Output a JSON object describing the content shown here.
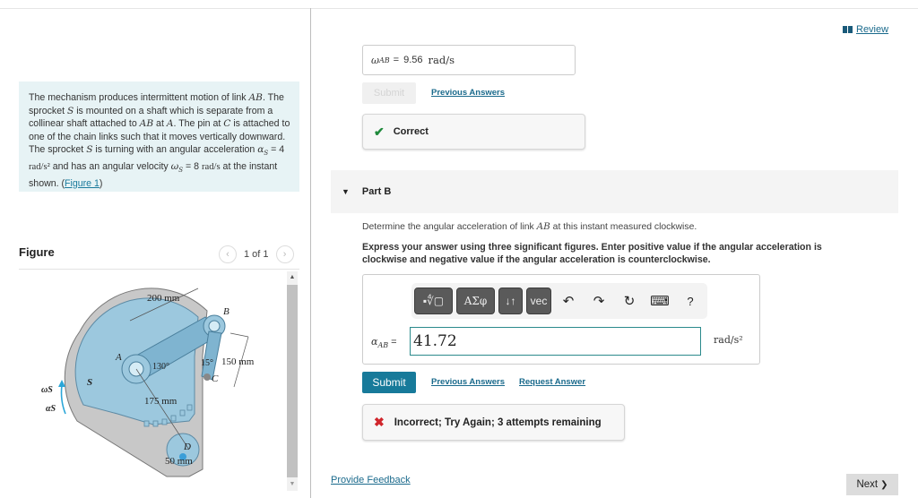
{
  "problem": {
    "text_parts": {
      "p1": "The mechanism produces intermittent motion of link ",
      "ab1": "AB",
      "p2": ". The sprocket ",
      "s1": "S",
      "p3": " is mounted on a shaft which is separate from a collinear shaft attached to ",
      "ab2": "AB",
      "p4": " at ",
      "a1": "A",
      "p5": ". The pin at ",
      "c1": "C",
      "p6": " is attached to one of the chain links such that it moves vertically downward. The sprocket ",
      "s2": "S",
      "p7": " is turning with an angular acceleration ",
      "alpha_sym": "α",
      "alpha_sub": "S",
      "alpha_val": " = 4 ",
      "alpha_unit": "rad/s²",
      "p8": " and has an angular velocity ",
      "omega_sym": "ω",
      "omega_sub": "S",
      "omega_val": " = 8 ",
      "omega_unit": "rad/s",
      "p9": " at the instant shown. (",
      "figure_link": "Figure 1",
      "p10": ")"
    }
  },
  "figure": {
    "title": "Figure",
    "counter": "1 of 1",
    "prev_icon": "‹",
    "next_icon": "›",
    "labels": {
      "d200": "200 mm",
      "b": "B",
      "a": "A",
      "angle130": "130°",
      "angle15": "15°",
      "d150": "150 mm",
      "c": "C",
      "s": "S",
      "d175": "175 mm",
      "d": "D",
      "d50": "50 mm",
      "omega": "ωS",
      "alpha": "αS"
    }
  },
  "header": {
    "review_label": "Review"
  },
  "partA": {
    "symbol": "ω",
    "subscript": "AB",
    "equals": "=",
    "value": "9.56",
    "unit": "rad/s",
    "submit_label": "Submit",
    "previous_answers_label": "Previous Answers",
    "feedback": "Correct",
    "feedback_icon": "✔"
  },
  "partB": {
    "arrow": "▼",
    "title": "Part B",
    "question_pre": "Determine the angular acceleration of link ",
    "question_ab": "AB",
    "question_post": " at this instant measured clockwise.",
    "instructions": "Express your answer using three significant figures. Enter positive value if the angular acceleration is clockwise and negative value if the angular acceleration is counterclockwise.",
    "toolbar": {
      "templates_label": "▪∜▢",
      "symbols_label": "ΑΣφ",
      "updown_label": "↓↑",
      "vec_label": "vec",
      "undo_icon": "↶",
      "redo_icon": "↷",
      "reset_icon": "↻",
      "keyboard_icon": "⌨",
      "help_label": "?"
    },
    "answer_symbol": "α",
    "answer_subscript": "AB",
    "answer_equals": "=",
    "answer_value": "41.72",
    "answer_unit": "rad/s²",
    "submit_label": "Submit",
    "previous_answers_label": "Previous Answers",
    "request_answer_label": "Request Answer",
    "feedback": "Incorrect; Try Again; 3 attempts remaining",
    "feedback_icon": "✖"
  },
  "footer": {
    "provide_feedback_label": "Provide Feedback",
    "next_label": "Next",
    "next_icon": "❯"
  },
  "colors": {
    "link": "#1a6a8c",
    "submit_active": "#177a9a",
    "correct": "#1f8a3c",
    "incorrect": "#d0262c",
    "problem_bg": "#e7f3f5",
    "sprocket": "#9cc8de"
  }
}
